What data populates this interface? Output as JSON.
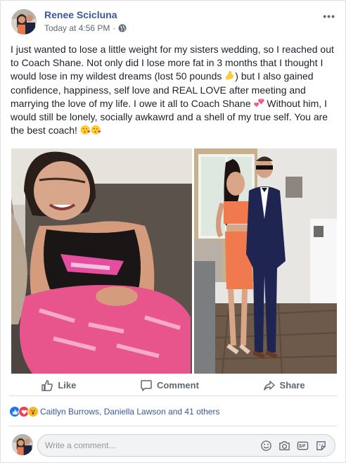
{
  "post": {
    "author": "Renee Scicluna",
    "timestamp": "Today at 4:56 PM",
    "privacy_separator": "·",
    "more_label": "•••",
    "text_part1": "I just wanted to lose a little weight for my sisters wedding, so I reached out to Coach Shane. Not only did I lose more fat in 3 months that I thought I would lose in my wildest dreams (lost 50 pounds ",
    "text_part2": ") but I also gained confidence, happiness, self love and REAL LOVE after meeting and marrying the love of my life. I owe it all to Coach Shane ",
    "text_part3": " Without him, I would still be lonely, socially awkawrd and a shell of my true self. You are the best coach! ",
    "emoji_icons": [
      "flexed-biceps-icon",
      "two-hearts-icon",
      "face-blowing-kiss-icon",
      "face-blowing-kiss-icon"
    ]
  },
  "actions": {
    "like": "Like",
    "comment": "Comment",
    "share": "Share"
  },
  "reactions": {
    "icons": [
      "like-reaction-icon",
      "love-reaction-icon",
      "wow-reaction-icon"
    ],
    "summary": "Caitlyn Burrows, Daniella Lawson and 41 others"
  },
  "comment_box": {
    "placeholder": "Write a comment...",
    "icons": [
      "emoji-icon",
      "camera-icon",
      "gif-icon",
      "sticker-icon"
    ]
  },
  "colors": {
    "link": "#385898",
    "secondary": "#606770",
    "like_blue": "#1877f2",
    "love_red": "#f33e58",
    "wow_yellow": "#f7b928"
  }
}
